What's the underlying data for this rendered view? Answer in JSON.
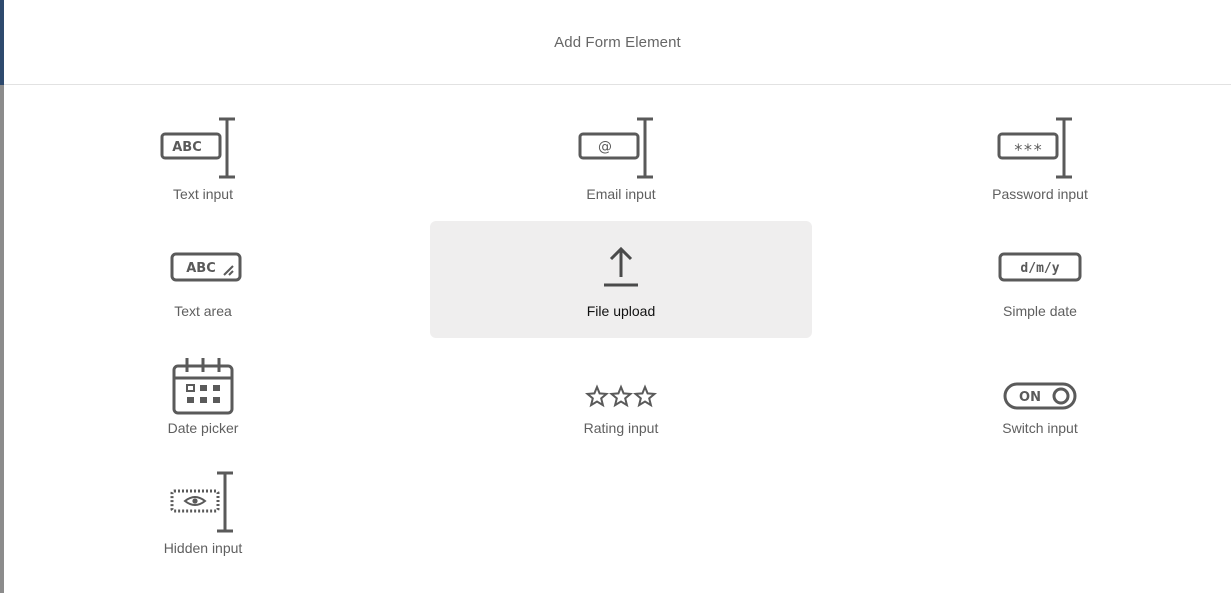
{
  "dialog": {
    "title": "Add Form Element"
  },
  "elements": [
    {
      "label": "Text input",
      "icon": "text-input-icon"
    },
    {
      "label": "Email input",
      "icon": "email-input-icon"
    },
    {
      "label": "Password input",
      "icon": "password-input-icon"
    },
    {
      "label": "Text area",
      "icon": "text-area-icon"
    },
    {
      "label": "File upload",
      "icon": "file-upload-icon",
      "selected": true
    },
    {
      "label": "Simple date",
      "icon": "simple-date-icon"
    },
    {
      "label": "Date picker",
      "icon": "date-picker-icon"
    },
    {
      "label": "Rating input",
      "icon": "rating-input-icon"
    },
    {
      "label": "Switch input",
      "icon": "switch-input-icon"
    },
    {
      "label": "Hidden input",
      "icon": "hidden-input-icon"
    }
  ],
  "icon_glyphs": {
    "text": "ABC",
    "email": "@",
    "password": "***",
    "textarea": "ABC",
    "date": "d/m/y",
    "switch": "ON"
  },
  "colors": {
    "icon": "#5a5a5a",
    "label": "#5f5f5f",
    "selected_bg": "#efeeee",
    "header_text": "#666666",
    "accent_edge": "#2e4a6e"
  }
}
